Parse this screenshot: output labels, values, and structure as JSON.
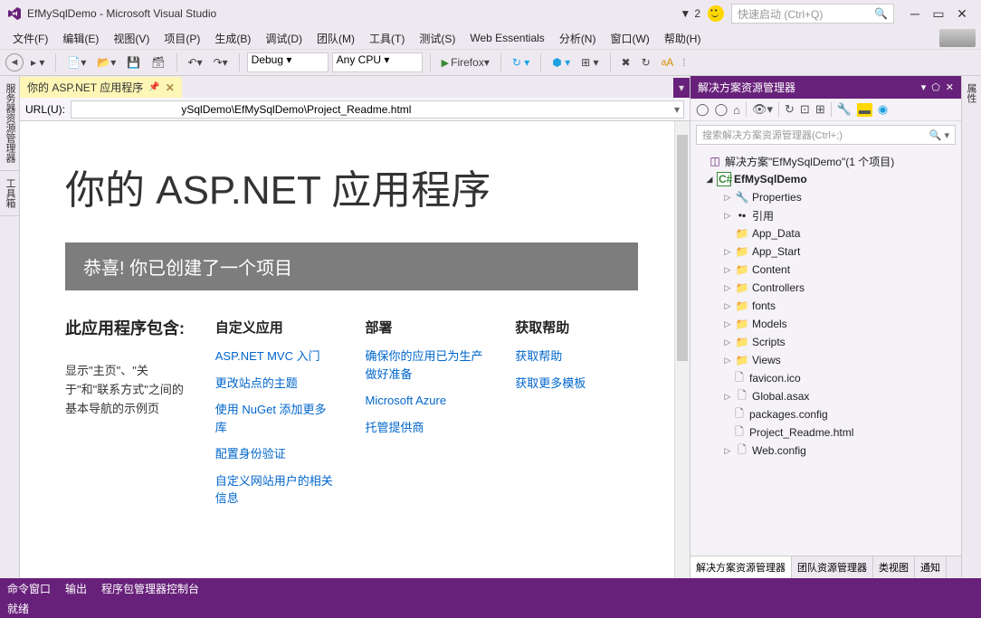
{
  "titlebar": {
    "title": "EfMySqlDemo - Microsoft Visual Studio",
    "notif_count": "2",
    "quick_launch_placeholder": "快速启动 (Ctrl+Q)"
  },
  "menu": [
    "文件(F)",
    "编辑(E)",
    "视图(V)",
    "项目(P)",
    "生成(B)",
    "调试(D)",
    "团队(M)",
    "工具(T)",
    "测试(S)",
    "Web Essentials",
    "分析(N)",
    "窗口(W)",
    "帮助(H)"
  ],
  "toolbar": {
    "config": "Debug",
    "platform": "Any CPU",
    "run_target": "Firefox"
  },
  "doctab": {
    "label": "你的 ASP.NET 应用程序"
  },
  "urlbar": {
    "label": "URL(U):",
    "value_suffix": "ySqlDemo\\EfMySqlDemo\\Project_Readme.html"
  },
  "page": {
    "h1": "你的 ASP.NET 应用程序",
    "banner": "恭喜! 你已创建了一个项目",
    "col0_title": "此应用程序包含:",
    "col0_text": "显示\"主页\"、\"关于\"和\"联系方式\"之间的基本导航的示例页",
    "col1_title": "自定义应用",
    "col1_links": [
      "ASP.NET MVC 入门",
      "更改站点的主题",
      "使用 NuGet 添加更多库",
      "配置身份验证",
      "自定义网站用户的相关信息"
    ],
    "col2_title": "部署",
    "col2_links": [
      "确保你的应用已为生产做好准备",
      "Microsoft Azure",
      "托管提供商"
    ],
    "col3_title": "获取帮助",
    "col3_links": [
      "获取帮助",
      "获取更多模板"
    ]
  },
  "solution_explorer": {
    "title": "解决方案资源管理器",
    "search_placeholder": "搜索解决方案资源管理器(Ctrl+;)",
    "solution_label": "解决方案\"EfMySqlDemo\"(1 个项目)",
    "project": "EfMySqlDemo",
    "nodes": {
      "properties": "Properties",
      "references": "引用",
      "appdata": "App_Data",
      "appstart": "App_Start",
      "content": "Content",
      "controllers": "Controllers",
      "fonts": "fonts",
      "models": "Models",
      "scripts": "Scripts",
      "views": "Views",
      "favicon": "favicon.ico",
      "global": "Global.asax",
      "packages": "packages.config",
      "readme": "Project_Readme.html",
      "webconfig": "Web.config"
    },
    "tabs": [
      "解决方案资源管理器",
      "团队资源管理器",
      "类视图",
      "通知"
    ]
  },
  "left_tabs": [
    "服务器资源管理器",
    "工具箱"
  ],
  "right_tabs": [
    "属性"
  ],
  "bottom_tabs": [
    "命令窗口",
    "输出",
    "程序包管理器控制台"
  ],
  "status": "就绪"
}
